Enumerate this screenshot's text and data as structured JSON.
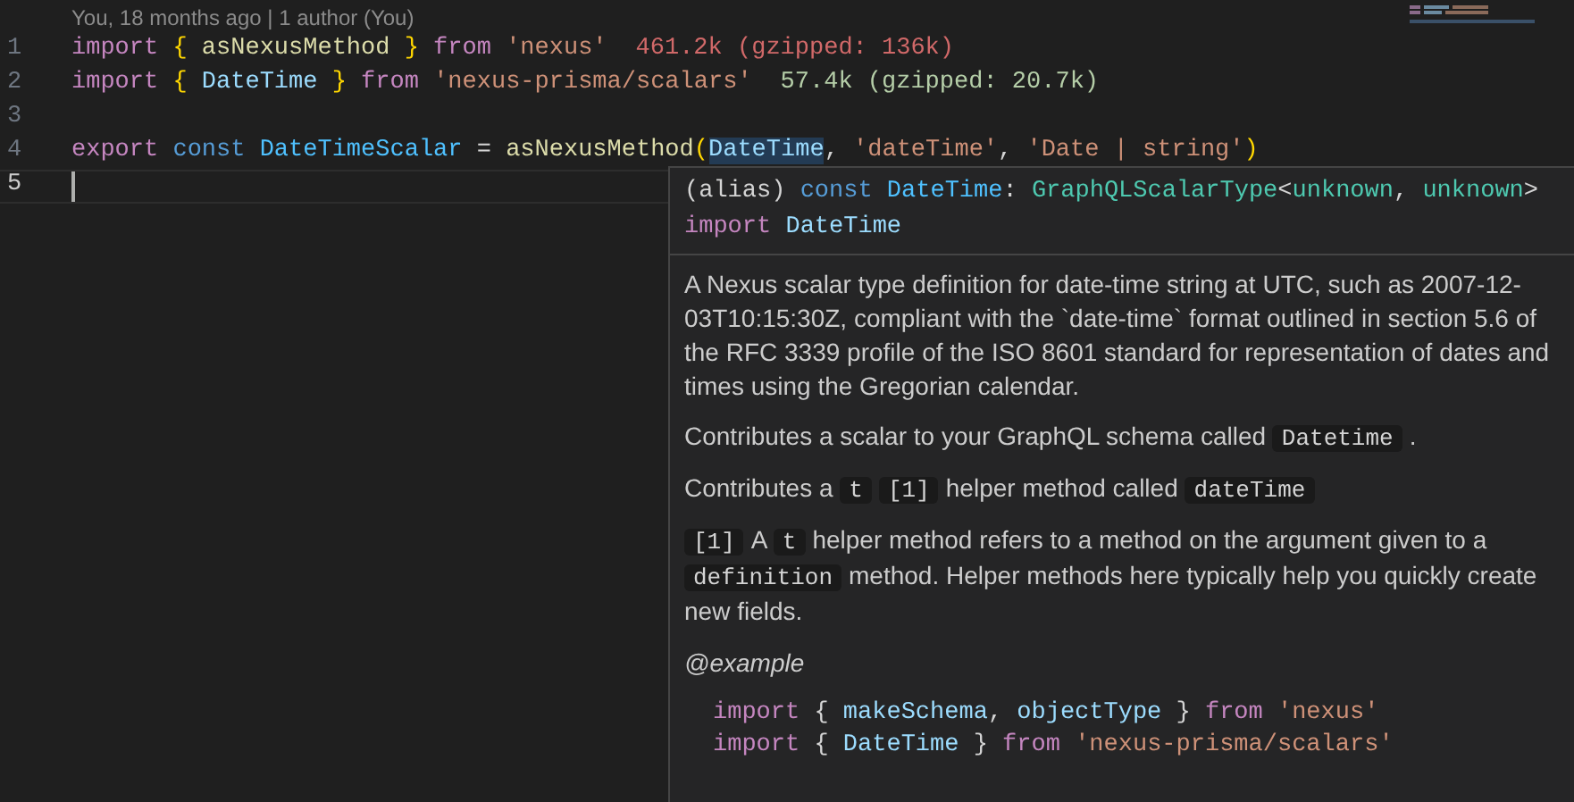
{
  "blame": "You, 18 months ago | 1 author (You)",
  "lines": [
    {
      "number": "1",
      "current": false,
      "tokens": [
        {
          "kind": "control",
          "text": "import "
        },
        {
          "kind": "bracket",
          "text": "{ "
        },
        {
          "kind": "function",
          "text": "asNexusMethod "
        },
        {
          "kind": "bracket",
          "text": "} "
        },
        {
          "kind": "control",
          "text": "from "
        },
        {
          "kind": "string",
          "text": "'nexus'"
        }
      ],
      "cost": {
        "text": "461.2k (gzipped: 136k)",
        "color": "#d16969"
      }
    },
    {
      "number": "2",
      "current": false,
      "tokens": [
        {
          "kind": "control",
          "text": "import "
        },
        {
          "kind": "bracket",
          "text": "{ "
        },
        {
          "kind": "variable",
          "text": "DateTime "
        },
        {
          "kind": "bracket",
          "text": "} "
        },
        {
          "kind": "control",
          "text": "from "
        },
        {
          "kind": "string",
          "text": "'nexus-prisma/scalars'"
        }
      ],
      "cost": {
        "text": "57.4k (gzipped: 20.7k)",
        "color": "#b5cea8"
      }
    },
    {
      "number": "3",
      "current": false
    },
    {
      "number": "4",
      "current": false,
      "tokens": [
        {
          "kind": "control",
          "text": "export "
        },
        {
          "kind": "keyword",
          "text": "const "
        },
        {
          "kind": "constant",
          "text": "DateTimeScalar "
        },
        {
          "kind": "plain",
          "text": "= "
        },
        {
          "kind": "function",
          "text": "asNexusMethod"
        },
        {
          "kind": "bracket",
          "text": "("
        },
        {
          "kind": "hovered",
          "text": "DateTime"
        },
        {
          "kind": "plain",
          "text": ", "
        },
        {
          "kind": "string",
          "text": "'dateTime'"
        },
        {
          "kind": "plain",
          "text": ", "
        },
        {
          "kind": "string",
          "text": "'Date | string'"
        },
        {
          "kind": "bracket",
          "text": ")"
        }
      ]
    },
    {
      "number": "5",
      "current": true
    }
  ],
  "hover": {
    "signature": [
      [
        {
          "kind": "plain",
          "text": "(alias) "
        },
        {
          "kind": "keyword",
          "text": "const "
        },
        {
          "kind": "constant",
          "text": "DateTime"
        },
        {
          "kind": "plain",
          "text": ": "
        },
        {
          "kind": "type",
          "text": "GraphQLScalarType"
        },
        {
          "kind": "plain",
          "text": "<"
        },
        {
          "kind": "type",
          "text": "unknown"
        },
        {
          "kind": "plain",
          "text": ", "
        },
        {
          "kind": "type",
          "text": "unknown"
        },
        {
          "kind": "plain",
          "text": ">"
        }
      ],
      [
        {
          "kind": "control",
          "text": "import "
        },
        {
          "kind": "variable",
          "text": "DateTime"
        }
      ]
    ],
    "paragraphs": [
      [
        {
          "kind": "text",
          "text": "A Nexus scalar type definition for date-time string at UTC, such as 2007-12-03T10:15:30Z, compliant with the `date-time` format outlined in section 5.6 of the RFC 3339 profile of the ISO 8601 standard for representation of dates and times using the Gregorian calendar."
        }
      ],
      [
        {
          "kind": "text",
          "text": "Contributes a scalar to your GraphQL schema called "
        },
        {
          "kind": "code",
          "text": "Datetime"
        },
        {
          "kind": "text",
          "text": "."
        }
      ],
      [
        {
          "kind": "text",
          "text": "Contributes a "
        },
        {
          "kind": "code",
          "text": "t"
        },
        {
          "kind": "code",
          "text": "[1]"
        },
        {
          "kind": "text",
          "text": "helper method called "
        },
        {
          "kind": "code",
          "text": "dateTime"
        }
      ],
      [
        {
          "kind": "code",
          "text": "[1]"
        },
        {
          "kind": "text",
          "text": "A "
        },
        {
          "kind": "code",
          "text": "t"
        },
        {
          "kind": "text",
          "text": "helper method refers to a method on the argument given to a "
        },
        {
          "kind": "code",
          "text": "definition"
        },
        {
          "kind": "text",
          "text": "method. Helper methods here typically help you quickly create new fields."
        }
      ]
    ],
    "tag": "@example",
    "example": [
      [
        {
          "kind": "control",
          "text": "import "
        },
        {
          "kind": "plain",
          "text": "{ "
        },
        {
          "kind": "variable",
          "text": "makeSchema"
        },
        {
          "kind": "plain",
          "text": ", "
        },
        {
          "kind": "variable",
          "text": "objectType "
        },
        {
          "kind": "plain",
          "text": "} "
        },
        {
          "kind": "control",
          "text": "from "
        },
        {
          "kind": "string",
          "text": "'nexus'"
        }
      ],
      [
        {
          "kind": "control",
          "text": "import "
        },
        {
          "kind": "plain",
          "text": "{ "
        },
        {
          "kind": "variable",
          "text": "DateTime "
        },
        {
          "kind": "plain",
          "text": "} "
        },
        {
          "kind": "control",
          "text": "from "
        },
        {
          "kind": "string",
          "text": "'nexus-prisma/scalars'"
        }
      ]
    ]
  }
}
